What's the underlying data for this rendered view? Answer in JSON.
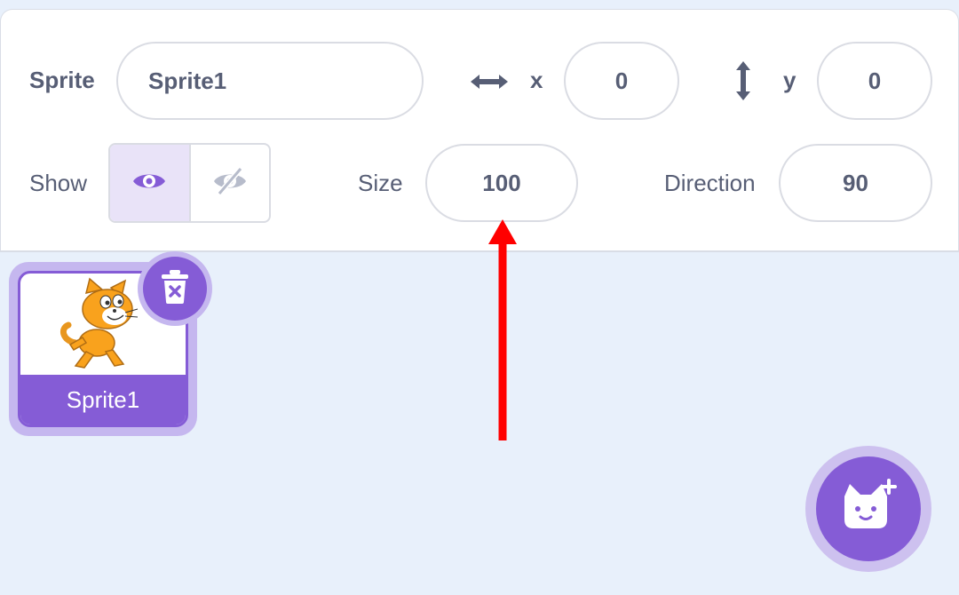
{
  "sprite_info": {
    "sprite_label": "Sprite",
    "sprite_name_value": "Sprite1",
    "x_label": "x",
    "x_value": "0",
    "y_label": "y",
    "y_value": "0",
    "show_label": "Show",
    "show_visible": true,
    "size_label": "Size",
    "size_value": "100",
    "direction_label": "Direction",
    "direction_value": "90"
  },
  "sprite_list": {
    "items": [
      {
        "name": "Sprite1",
        "selected": true
      }
    ]
  },
  "icons": {
    "x_axis": "arrows-horizontal-icon",
    "y_axis": "arrows-vertical-icon",
    "show": "eye-icon",
    "hide": "eye-slash-icon",
    "delete": "trash-icon",
    "add_sprite": "cat-plus-icon"
  },
  "colors": {
    "accent": "#855cd6",
    "accent_light": "#c5b7ef",
    "text": "#575e75",
    "background": "#e8f0fb",
    "annotation": "#ff0000"
  }
}
